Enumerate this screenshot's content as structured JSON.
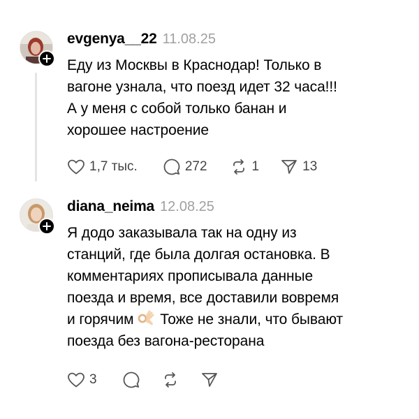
{
  "posts": [
    {
      "username": "evgenya__22",
      "date": "11.08.25",
      "text": "Еду из Москвы в Краснодар! Только в\nвагоне узнала, что поезд идет 32 часа!!!\nА у меня с собой только банан и\nхорошее настроение",
      "likes": "1,7 тыс.",
      "replies": "272",
      "reposts": "1",
      "shares": "13"
    },
    {
      "username": "diana_neima",
      "date": "12.08.25",
      "text_before": "Я додо заказывала так на одну из\nстанций, где была долгая остановка. В\nкомментариях прописывала данные\nпоезда и время, все доставили вовремя\nи горячим",
      "emoji": "ok-hand-emoji",
      "text_after": " Тоже не знали, что бывают\nпоезда без вагона-ресторана",
      "likes": "3"
    }
  ],
  "icons": {
    "like": "heart-icon",
    "reply": "comment-icon",
    "repost": "repost-icon",
    "share": "send-icon",
    "follow": "plus-icon"
  }
}
